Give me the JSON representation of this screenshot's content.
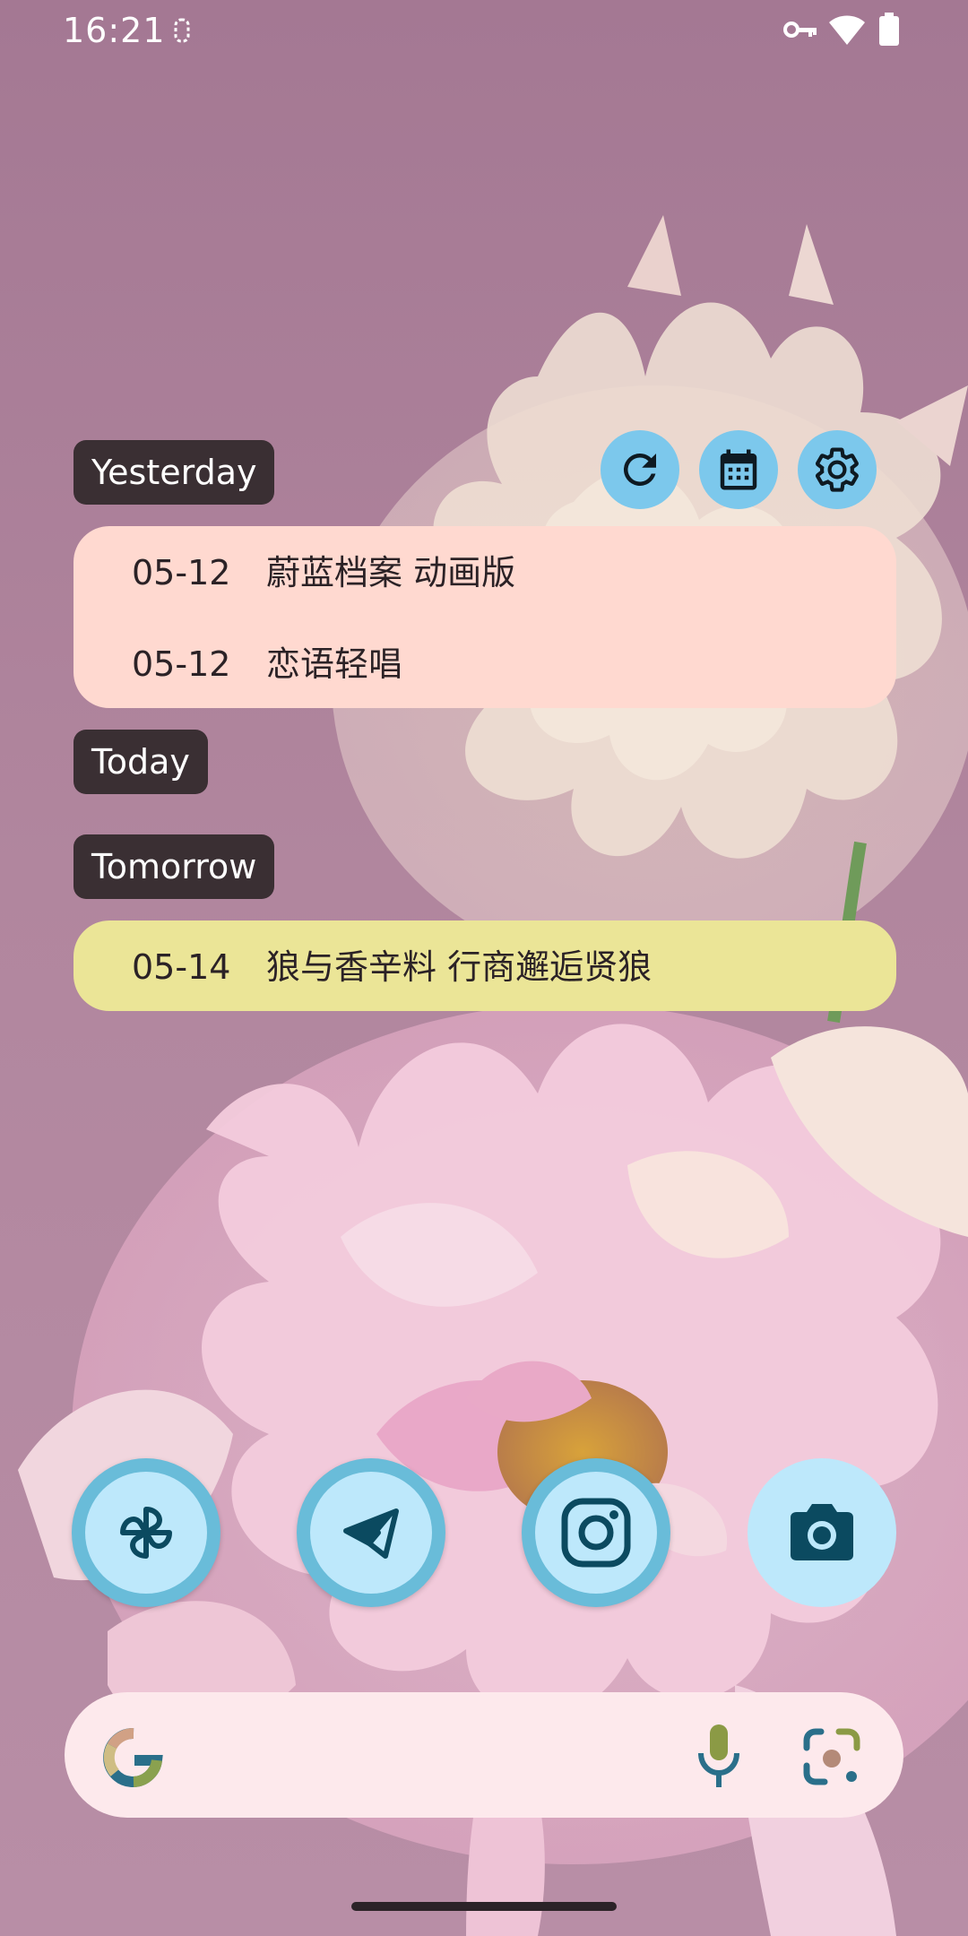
{
  "status_bar": {
    "time": "16:21",
    "icons": [
      "screen-record-icon",
      "vpn-key-icon",
      "wifi-icon",
      "battery-icon"
    ]
  },
  "widget": {
    "buttons": [
      "refresh-icon",
      "calendar-icon",
      "settings-icon"
    ],
    "sections": [
      {
        "label": "Yesterday",
        "events": [
          {
            "date": "05-12",
            "title": "蔚蓝档案 动画版"
          },
          {
            "date": "05-12",
            "title": "恋语轻唱"
          }
        ]
      },
      {
        "label": "Today",
        "events": []
      },
      {
        "label": "Tomorrow",
        "events": [
          {
            "date": "05-14",
            "title": "狼与香辛料 行商邂逅贤狼"
          }
        ]
      }
    ],
    "colors": {
      "label_bg": "#3a2f33",
      "yesterday_card": "#ffd9d0",
      "tomorrow_card": "#ebe597",
      "button_bg": "#7cc8ec"
    }
  },
  "dock": {
    "apps": [
      "pinwheel-icon",
      "telegram-icon",
      "instagram-icon",
      "camera-icon"
    ]
  },
  "search_bar": {
    "icons": [
      "google-logo-icon",
      "microphone-icon",
      "google-lens-icon"
    ]
  }
}
